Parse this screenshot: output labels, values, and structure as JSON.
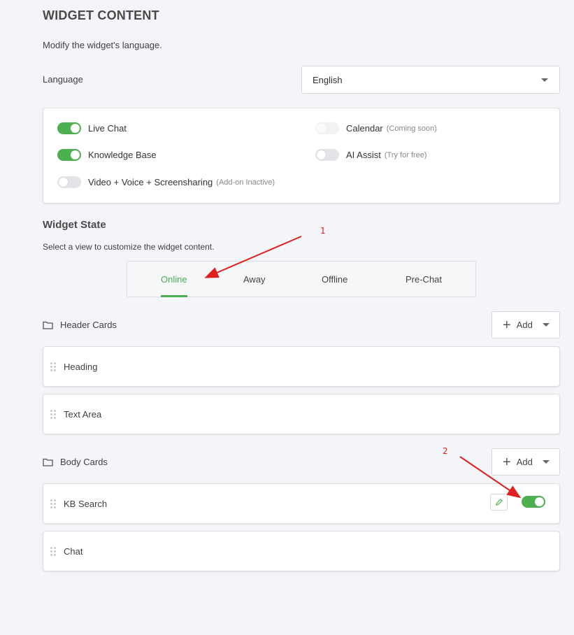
{
  "header": {
    "title": "WIDGET CONTENT",
    "subtitle": "Modify the widget's language."
  },
  "language": {
    "label": "Language",
    "value": "English"
  },
  "features": [
    {
      "label": "Live Chat",
      "note": "",
      "state": "on"
    },
    {
      "label": "Knowledge Base",
      "note": "",
      "state": "on"
    },
    {
      "label": "Video + Voice + Screensharing",
      "note": "(Add-on Inactive)",
      "state": "off"
    },
    {
      "label": "Calendar",
      "note": "(Coming soon)",
      "state": "disabled"
    },
    {
      "label": "AI Assist",
      "note": "(Try for free)",
      "state": "off"
    }
  ],
  "widget_state": {
    "title": "Widget State",
    "subtitle": "Select a view to customize the widget content.",
    "tabs": [
      "Online",
      "Away",
      "Offline",
      "Pre-Chat"
    ],
    "active_tab": "Online"
  },
  "header_cards": {
    "label": "Header Cards",
    "add_label": "Add",
    "items": [
      "Heading",
      "Text Area"
    ]
  },
  "body_cards": {
    "label": "Body Cards",
    "add_label": "Add",
    "items": [
      {
        "label": "KB Search",
        "enabled": true
      },
      {
        "label": "Chat"
      }
    ]
  },
  "annotations": [
    "1",
    "2"
  ],
  "colors": {
    "accent": "#4caf50",
    "annotation": "#e02020",
    "background": "#f4f5f8"
  }
}
